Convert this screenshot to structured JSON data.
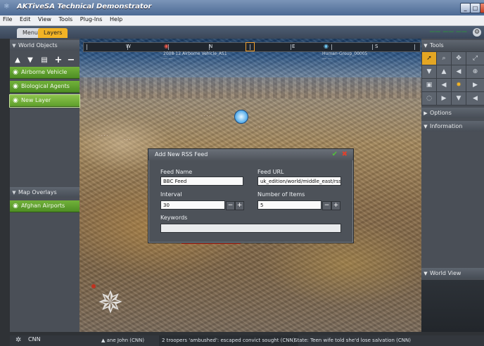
{
  "window": {
    "title": "AKTiveSA Technical Demonstrator",
    "controls": {
      "minimize": "_",
      "maximize": "□",
      "close": "✕"
    }
  },
  "menubar": {
    "items": [
      "File",
      "Edit",
      "View",
      "Tools",
      "Plug-Ins",
      "Help"
    ]
  },
  "tabs": [
    {
      "label": "Menu"
    },
    {
      "label": "Layers",
      "active": true
    }
  ],
  "top_right_text": "—— —— ——",
  "left_panel": {
    "world_objects": {
      "header": "World Objects",
      "toolbar": [
        "▲",
        "▼",
        "▤",
        "+",
        "−"
      ],
      "layers": [
        "Airborne Vehicle",
        "Biological Agents",
        "New Layer"
      ]
    },
    "map_overlays": {
      "header": "Map Overlays",
      "layers": [
        "Afghan Airports"
      ]
    }
  },
  "right_panel": {
    "tools_header": "Tools",
    "tool_icons": [
      "➚",
      "⌕",
      "✥",
      "⤢",
      "▼",
      "▲",
      "◀",
      "⊕",
      "▣",
      "◀",
      "✸",
      "▶",
      "◌",
      "▶",
      "▼",
      "◀"
    ],
    "sections": [
      "Options",
      "Information"
    ],
    "world_view": "World View"
  },
  "ruler": {
    "compass_letters": [
      "W",
      "N",
      "E",
      "S"
    ],
    "marker_labels": [
      "2008-12 Airborne Vehicle_AS1",
      "Human-Group_00005"
    ]
  },
  "dialog": {
    "title": "Add New RSS Feed",
    "feed_name_label": "Feed Name",
    "feed_name_value": "BBC Feed",
    "feed_url_label": "Feed URL",
    "feed_url_value": "uk_edition/world/middle_east/rss.xml",
    "interval_label": "Interval",
    "interval_value": "30",
    "items_label": "Number of Items",
    "items_value": "5",
    "keywords_label": "Keywords",
    "keywords_value": "",
    "ok_symbol": "✔",
    "cancel_symbol": "✖",
    "minus": "−",
    "plus": "+"
  },
  "statusbar": {
    "source": "CNN",
    "headlines": [
      "▲  ane John (CNN)",
      "2 troopers 'ambushed': escaped convict sought (CNN)",
      "State: Teen wife told she'd lose salvation (CNN)"
    ]
  },
  "colors": {
    "layer_green": "#5fa030",
    "accent_orange": "#f2b325",
    "title_blue": "#5b79a3"
  }
}
